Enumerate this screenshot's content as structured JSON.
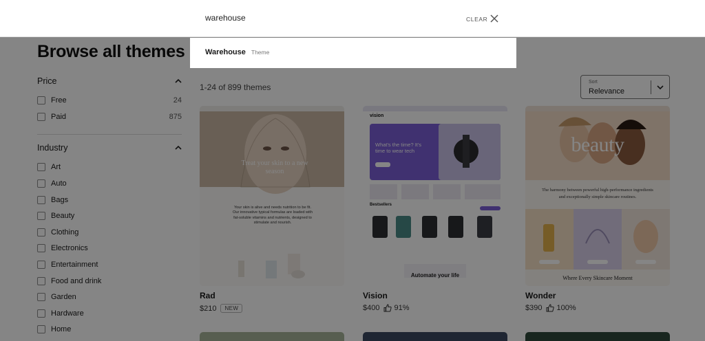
{
  "search": {
    "query": "warehouse",
    "clear_label": "CLEAR",
    "close_icon": "close-icon"
  },
  "suggestions": [
    {
      "name": "Warehouse",
      "type": "Theme"
    }
  ],
  "page": {
    "title": "Browse all themes",
    "results_count": "1-24 of 899 themes"
  },
  "filters": {
    "price": {
      "title": "Price",
      "options": [
        {
          "label": "Free",
          "count": "24"
        },
        {
          "label": "Paid",
          "count": "875"
        }
      ]
    },
    "industry": {
      "title": "Industry",
      "options": [
        {
          "label": "Art"
        },
        {
          "label": "Auto"
        },
        {
          "label": "Bags"
        },
        {
          "label": "Beauty"
        },
        {
          "label": "Clothing"
        },
        {
          "label": "Electronics"
        },
        {
          "label": "Entertainment"
        },
        {
          "label": "Food and drink"
        },
        {
          "label": "Garden"
        },
        {
          "label": "Hardware"
        },
        {
          "label": "Home"
        }
      ]
    }
  },
  "sort": {
    "caption": "Sort",
    "value": "Relevance"
  },
  "themes": [
    {
      "name": "Rad",
      "price": "$210",
      "badge": "NEW",
      "preview": {
        "headline": "Treat your skin to a new season",
        "body": "Your skin is alive and needs nutrition to be fit. Our innovative typical formulas are loaded with fat-soluble vitamins and nutrients, designed to stimulate and nourish."
      }
    },
    {
      "name": "Vision",
      "price": "$400",
      "rating": "91%",
      "preview": {
        "logo": "vision",
        "hero": "What's the time? It's time to wear tech",
        "section": "Bestsellers",
        "footer": "Automate your life"
      }
    },
    {
      "name": "Wonder",
      "price": "$390",
      "rating": "100%",
      "preview": {
        "hero": "beauty",
        "tagline_1": "The harmony between powerful high-performance ingredients",
        "tagline_2": "and exceptionally simple skincare routines.",
        "footer": "Where Every Skincare Moment"
      }
    }
  ],
  "colors": {
    "overlay": "rgba(0,0,0,0.48)",
    "vision_purple": "#7b5fd6",
    "wonder_peach": "#f4dcc8"
  }
}
